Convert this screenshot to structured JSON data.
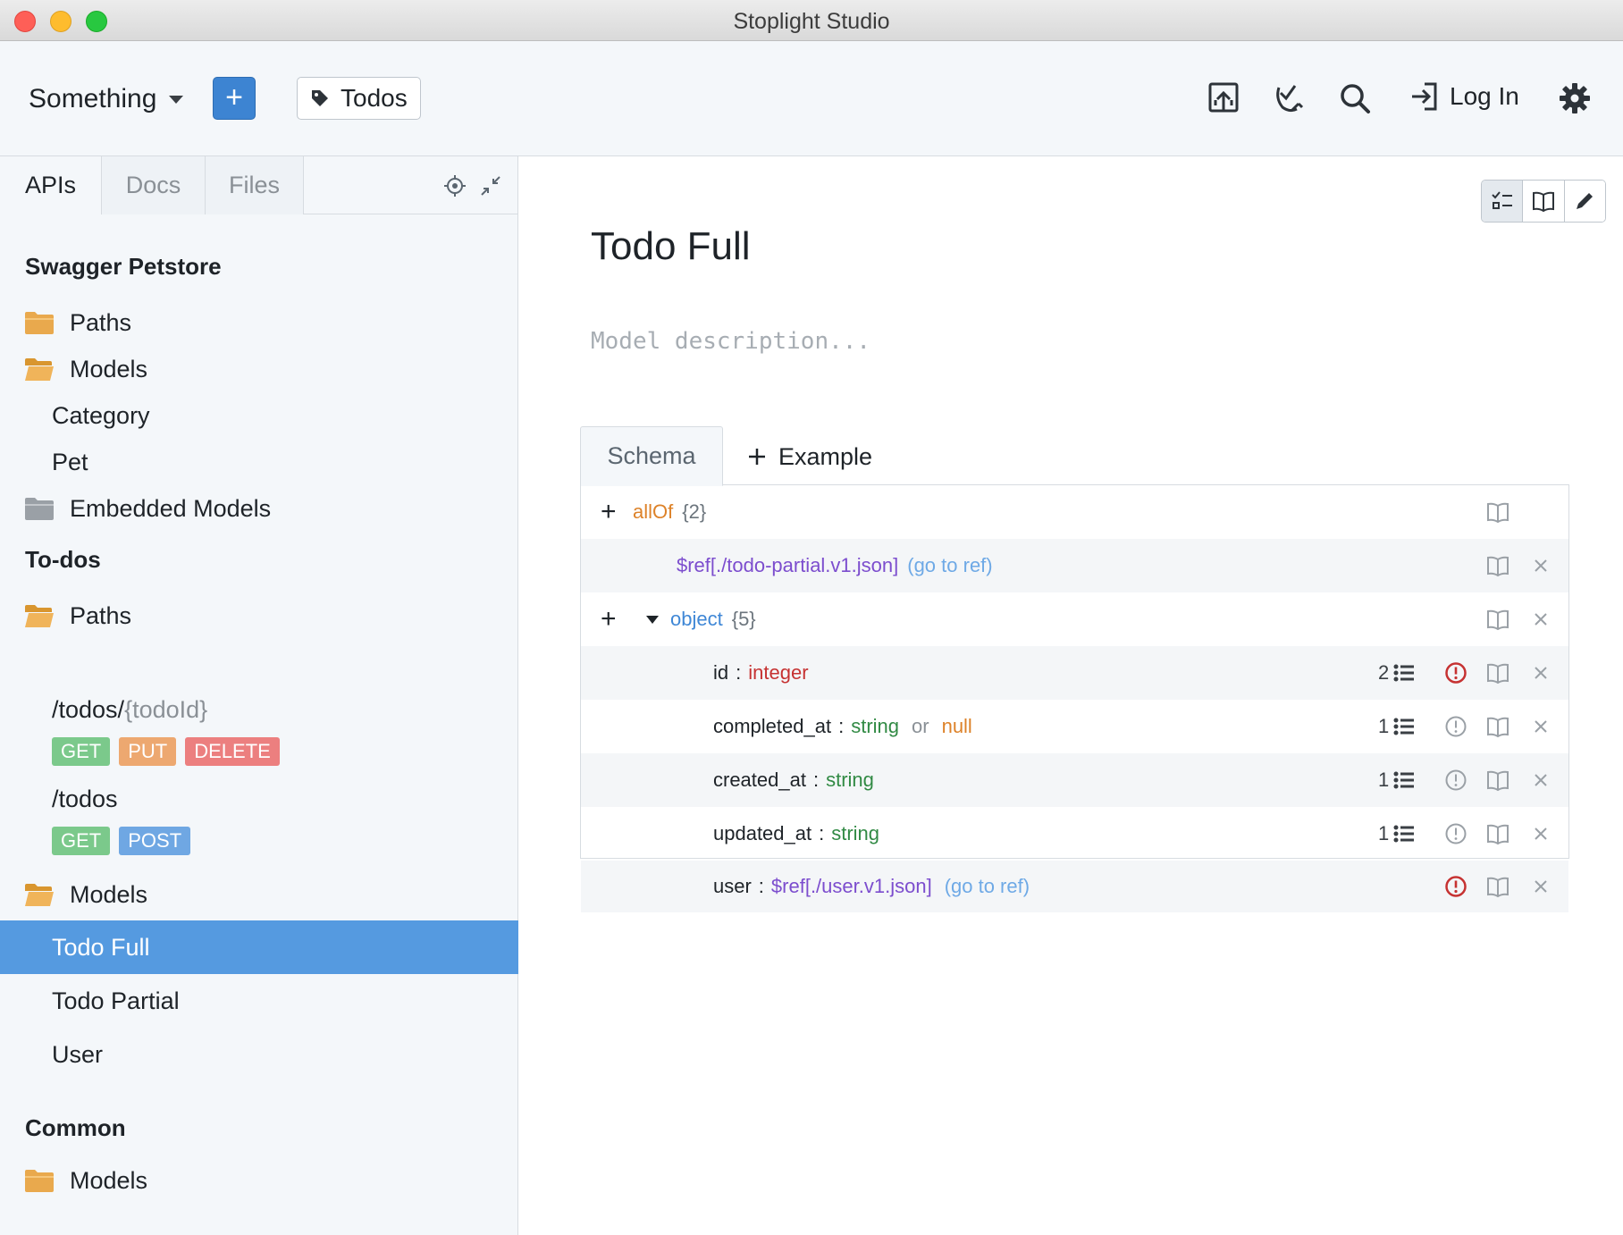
{
  "window": {
    "title": "Stoplight Studio"
  },
  "toolbar": {
    "project_name": "Something",
    "add_label": "+",
    "tag_label": "Todos",
    "login_label": "Log In"
  },
  "sidebar": {
    "tabs": [
      {
        "label": "APIs"
      },
      {
        "label": "Docs"
      },
      {
        "label": "Files"
      }
    ],
    "sections": [
      {
        "title": "Swagger Petstore",
        "paths_label": "Paths",
        "models_label": "Models",
        "models": [
          "Category",
          "Pet"
        ],
        "embedded_label": "Embedded Models"
      },
      {
        "title": "To-dos",
        "paths_label": "Paths",
        "paths": [
          {
            "base": "/todos/",
            "param": "{todoId}",
            "methods": [
              "GET",
              "PUT",
              "DELETE"
            ]
          },
          {
            "base": "/todos",
            "param": "",
            "methods": [
              "GET",
              "POST"
            ]
          }
        ],
        "models_label": "Models",
        "models": [
          "Todo Full",
          "Todo Partial",
          "User"
        ],
        "selected_model": "Todo Full"
      },
      {
        "title": "Common",
        "models_label": "Models"
      }
    ]
  },
  "main": {
    "title": "Todo Full",
    "description_placeholder": "Model description...",
    "tabs": {
      "schema": "Schema",
      "example": "Example"
    },
    "schema": {
      "allof": {
        "keyword": "allOf",
        "count": "{2}"
      },
      "ref": {
        "value": "$ref[./todo-partial.v1.json]",
        "link": "(go to ref)"
      },
      "object": {
        "keyword": "object",
        "count": "{5}"
      },
      "properties": [
        {
          "name": "id",
          "type": "integer",
          "validations": "2",
          "error": true
        },
        {
          "name": "completed_at",
          "type": "string",
          "or_label": "or",
          "alt_type": "null",
          "validations": "1",
          "error": false
        },
        {
          "name": "created_at",
          "type": "string",
          "validations": "1",
          "error": false
        },
        {
          "name": "updated_at",
          "type": "string",
          "validations": "1",
          "error": false
        },
        {
          "name": "user",
          "ref": "$ref[./user.v1.json]",
          "link": "(go to ref)",
          "error": true
        }
      ],
      "colon": ":"
    }
  },
  "colors": {
    "accent": "#3d84d2",
    "selected": "#559ae0",
    "get": "#7bc98b",
    "put": "#eda870",
    "delete": "#ec7f7f",
    "post": "#6fa7e3",
    "error": "#c63232"
  }
}
